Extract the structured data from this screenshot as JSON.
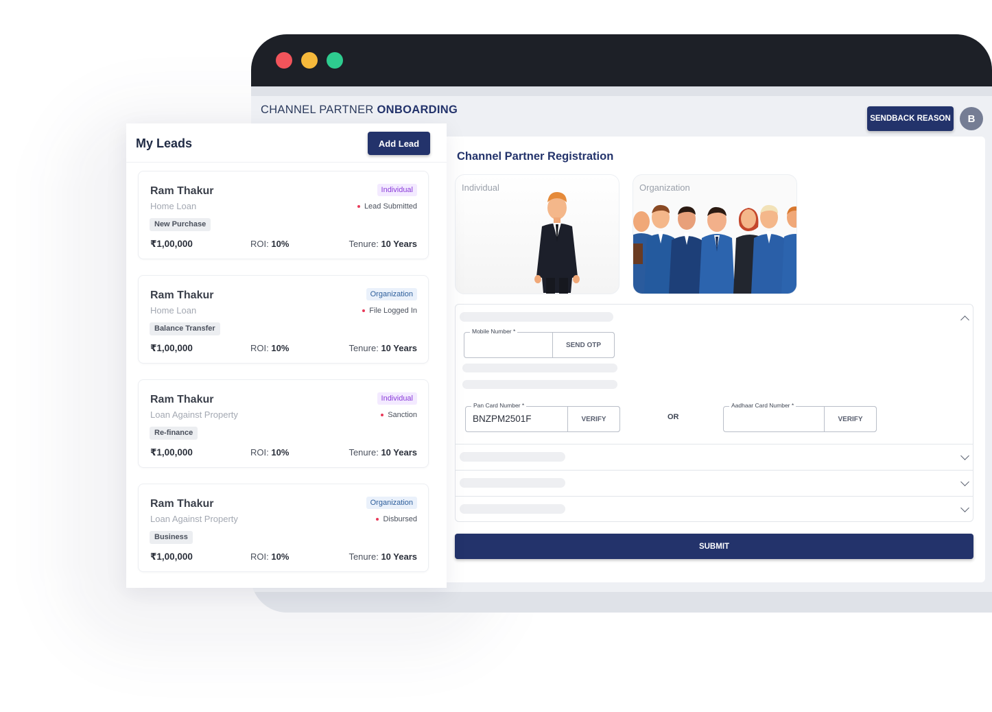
{
  "header": {
    "brand_light": "CHANNEL PARTNER",
    "brand_bold": "ONBOARDING",
    "sendback_label": "SENDBACK REASON",
    "avatar_initial": "B"
  },
  "registration": {
    "title": "Channel Partner Registration",
    "types": [
      {
        "label": "Individual"
      },
      {
        "label": "Organization"
      }
    ],
    "mobile": {
      "label": "Mobile Number *",
      "value": "",
      "button": "SEND OTP"
    },
    "pan": {
      "label": "Pan Card Number *",
      "value": "BNZPM2501F",
      "button": "VERIFY"
    },
    "or_text": "OR",
    "aadhaar": {
      "label": "Aadhaar Card Number *",
      "value": "",
      "button": "VERIFY"
    },
    "submit_label": "SUBMIT"
  },
  "leads": {
    "title": "My Leads",
    "add_label": "Add Lead",
    "roi_label": "ROI:",
    "tenure_label": "Tenure:",
    "items": [
      {
        "name": "Ram Thakur",
        "product": "Home Loan",
        "tag": "New Purchase",
        "type": "Individual",
        "status": "Lead Submitted",
        "amount": "₹1,00,000",
        "roi": "10%",
        "tenure": "10 Years"
      },
      {
        "name": "Ram Thakur",
        "product": "Home Loan",
        "tag": "Balance Transfer",
        "type": "Organization",
        "status": "File Logged In",
        "amount": "₹1,00,000",
        "roi": "10%",
        "tenure": "10 Years"
      },
      {
        "name": "Ram Thakur",
        "product": "Loan Against Property",
        "tag": "Re-finance",
        "type": "Individual",
        "status": "Sanction",
        "amount": "₹1,00,000",
        "roi": "10%",
        "tenure": "10 Years"
      },
      {
        "name": "Ram Thakur",
        "product": "Loan Against Property",
        "tag": "Business",
        "type": "Organization",
        "status": "Disbursed",
        "amount": "₹1,00,000",
        "roi": "10%",
        "tenure": "10 Years"
      }
    ]
  },
  "colors": {
    "primary": "#23336b",
    "titlebar": "#1d2027",
    "dot_red": "#f2545b",
    "dot_yellow": "#f6b93b",
    "dot_green": "#2ecc8f",
    "status_dot": "#e83a5a"
  }
}
